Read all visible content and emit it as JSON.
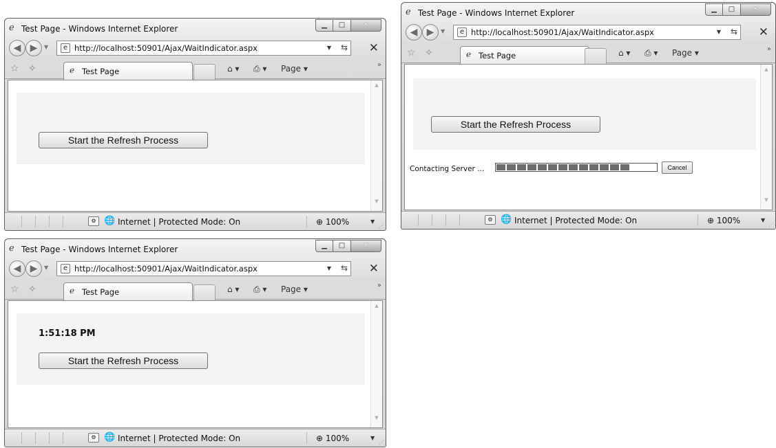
{
  "browser": {
    "title": "Test Page - Windows Internet Explorer",
    "url": "http://localhost:50901/Ajax/WaitIndicator.aspx",
    "tab_label": "Test Page",
    "page_menu": "Page ▾",
    "zone": "Internet | Protected Mode: On",
    "zoom": "100%"
  },
  "icons": {
    "app": "ie-logo-icon",
    "back": "back-arrow-icon",
    "forward": "forward-arrow-icon",
    "refresh": "refresh-icon",
    "stop": "stop-icon",
    "favorites": "star-icon",
    "add_favorites": "add-favorites-icon",
    "home": "home-icon",
    "print": "print-icon",
    "page": "page-icon",
    "globe": "globe-icon"
  },
  "windows": [
    {
      "state": "initial",
      "button_label": "Start the Refresh Process"
    },
    {
      "state": "refreshing",
      "button_label": "Start the Refresh Process",
      "status_text": "Contacting Server ...",
      "cancel_label": "Cancel",
      "progress_segments": 13
    },
    {
      "state": "complete",
      "time_text": "1:51:18 PM",
      "button_label": "Start the Refresh Process"
    }
  ]
}
